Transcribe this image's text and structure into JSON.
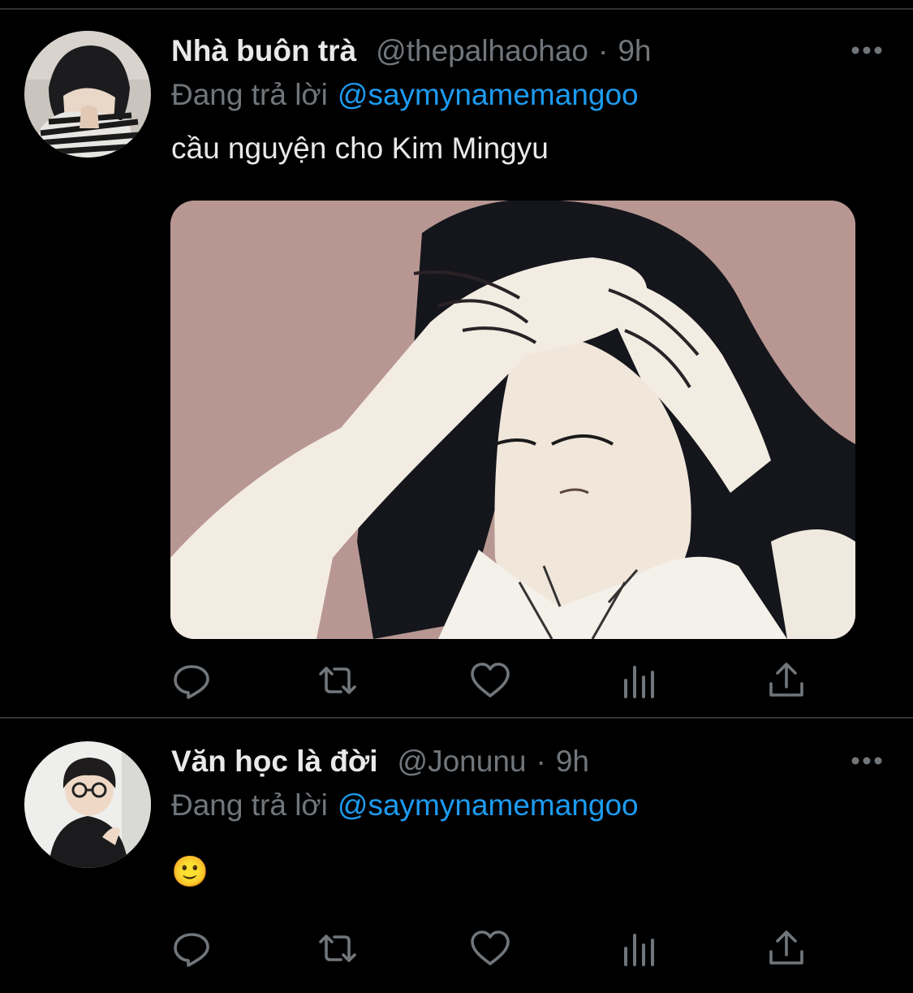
{
  "colors": {
    "background": "#000000",
    "text_primary": "#e7e9ea",
    "text_secondary": "#71767b",
    "link": "#1d9bf0",
    "divider": "#2f3336"
  },
  "tweets": [
    {
      "display_name": "Nhà buôn trà",
      "handle": "@thepalhaohao",
      "separator": "·",
      "time": "9h",
      "reply_prefix": "Đang trả lời",
      "reply_to": "@saymynamemangoo",
      "text": "cầu nguyện cho Kim Mingyu",
      "has_media": true,
      "actions": [
        "reply-icon",
        "retweet-icon",
        "like-icon",
        "analytics-icon",
        "share-icon"
      ]
    },
    {
      "display_name": "Văn học là đời",
      "handle": "@Jonunu",
      "separator": "·",
      "time": "9h",
      "reply_prefix": "Đang trả lời",
      "reply_to": "@saymynamemangoo",
      "text": "🙂",
      "has_media": false,
      "actions": [
        "reply-icon",
        "retweet-icon",
        "like-icon",
        "analytics-icon",
        "share-icon"
      ]
    }
  ]
}
